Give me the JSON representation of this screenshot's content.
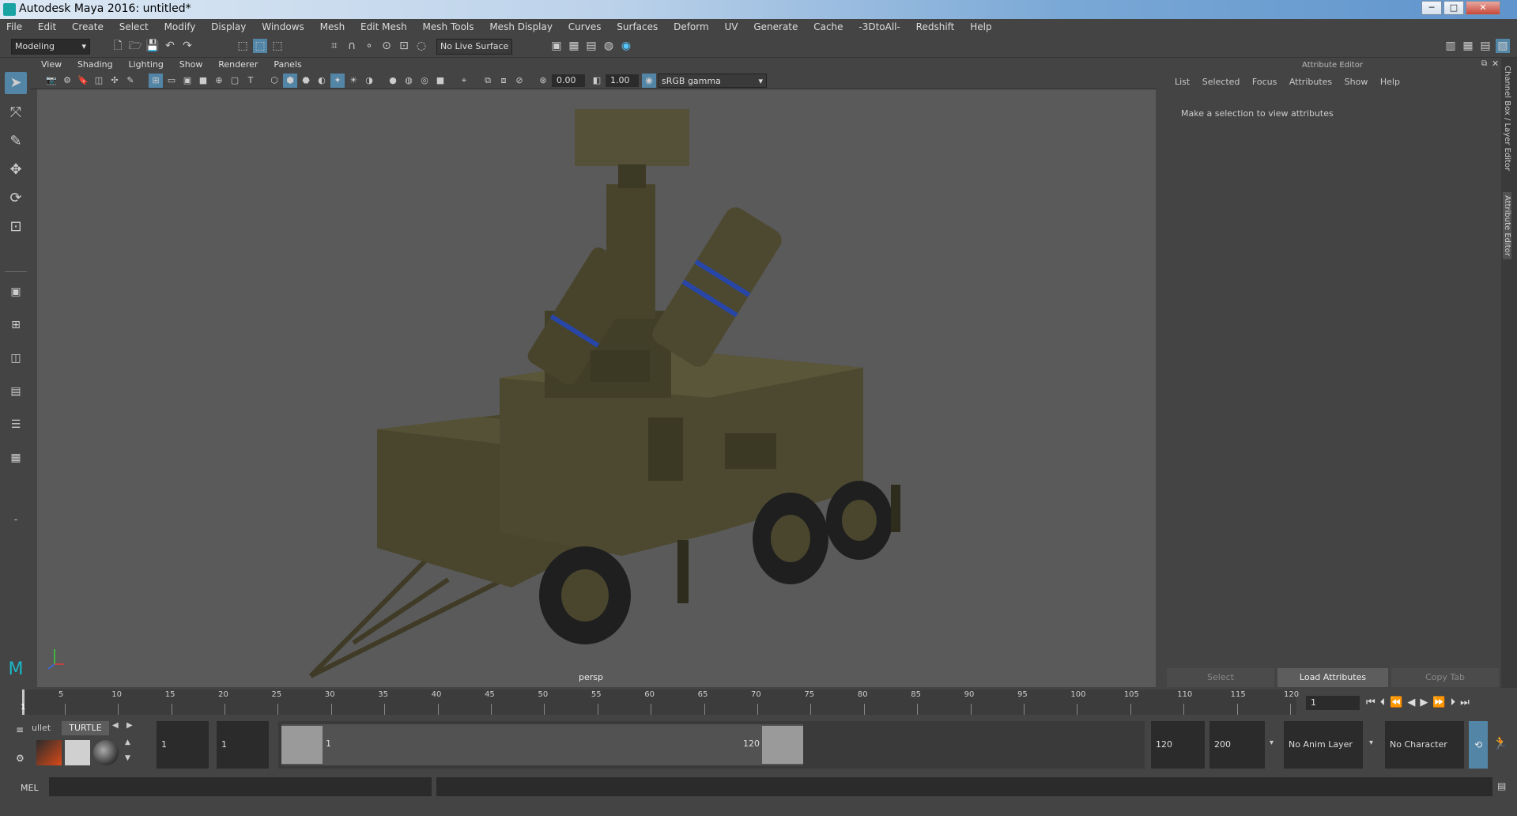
{
  "window": {
    "title": "Autodesk Maya 2016: untitled*",
    "controls": [
      "─",
      "□",
      "✕"
    ]
  },
  "menubar": [
    "File",
    "Edit",
    "Create",
    "Select",
    "Modify",
    "Display",
    "Windows",
    "Mesh",
    "Edit Mesh",
    "Mesh Tools",
    "Mesh Display",
    "Curves",
    "Surfaces",
    "Deform",
    "UV",
    "Generate",
    "Cache",
    "-3DtoAll-",
    "Redshift",
    "Help"
  ],
  "statusline": {
    "menuset": "Modeling",
    "live_surface": "No Live Surface"
  },
  "viewport": {
    "menu": [
      "View",
      "Shading",
      "Lighting",
      "Show",
      "Renderer",
      "Panels"
    ],
    "exposure": "0.00",
    "gamma": "1.00",
    "color_space": "sRGB gamma",
    "camera_label": "persp"
  },
  "attribute_editor": {
    "title": "Attribute Editor",
    "menu": [
      "List",
      "Selected",
      "Focus",
      "Attributes",
      "Show",
      "Help"
    ],
    "message": "Make a selection to view attributes",
    "buttons": {
      "select": "Select",
      "load": "Load Attributes",
      "copy": "Copy Tab"
    }
  },
  "side_tabs": [
    "Channel Box / Layer Editor",
    "Attribute Editor"
  ],
  "timeline": {
    "ticks": [
      "5",
      "10",
      "15",
      "20",
      "25",
      "30",
      "35",
      "40",
      "45",
      "50",
      "55",
      "60",
      "65",
      "70",
      "75",
      "80",
      "85",
      "90",
      "95",
      "100",
      "105",
      "110",
      "115",
      "120"
    ],
    "current_frame": "1",
    "current_frame_field": "1"
  },
  "shelf": {
    "tabs": [
      "ullet",
      "TURTLE"
    ]
  },
  "range": {
    "start": "1",
    "anim_start": "1",
    "slider_start": "1",
    "slider_end": "120",
    "end": "120",
    "anim_end": "200",
    "anim_layer": "No Anim Layer",
    "character_set": "No Character Set"
  },
  "command": {
    "label": "MEL"
  }
}
